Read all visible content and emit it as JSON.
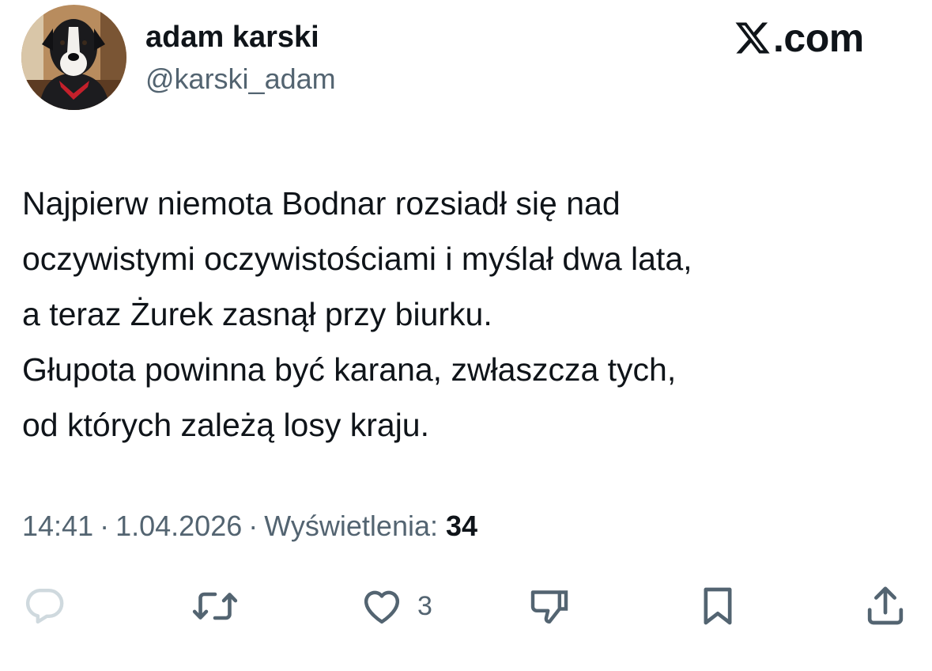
{
  "author": {
    "display_name": "adam karski",
    "handle": "@karski_adam",
    "avatar_icon": "dog-avatar"
  },
  "brand": {
    "logo_icon": "x-logo-icon",
    "text": ".com"
  },
  "tweet": {
    "lines": [
      "Najpierw niemota Bodnar rozsiadł się nad",
      "oczywistymi oczywistościami i myślał dwa lata,",
      "a teraz Żurek zasnął przy biurku.",
      "Głupota powinna być karana, zwłaszcza tych,",
      "od których zależą losy kraju."
    ]
  },
  "meta": {
    "time": "14:41",
    "separator": "·",
    "date": "1.04.2026",
    "views_label": "Wyświetlenia:",
    "views_count": "34"
  },
  "actions": {
    "reply_icon": "reply-icon",
    "repost_icon": "repost-icon",
    "like_icon": "heart-icon",
    "like_count": "3",
    "dislike_icon": "dislike-icon",
    "bookmark_icon": "bookmark-icon",
    "share_icon": "share-icon"
  },
  "colors": {
    "text_primary": "#0f1419",
    "text_secondary": "#536471",
    "reply_icon_disabled": "#cfd9de",
    "background": "#ffffff"
  }
}
